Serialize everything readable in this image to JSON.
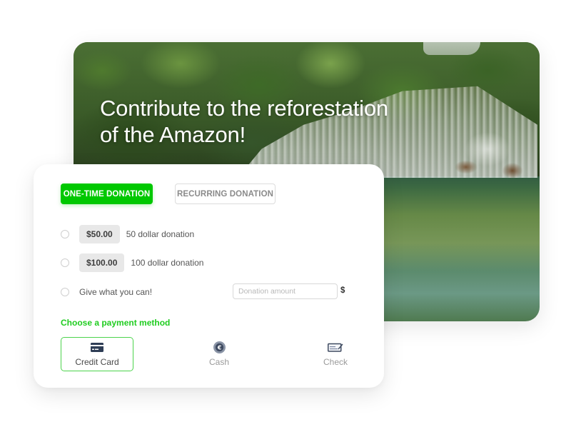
{
  "hero": {
    "title_line1": "Contribute to the reforestation",
    "title_line2": "of the Amazon!",
    "image_description": "waterfall-forest-photo"
  },
  "donation_form": {
    "tabs": [
      {
        "label": "ONE-TIME DONATION",
        "active": true
      },
      {
        "label": "RECURRING DONATION",
        "active": false
      }
    ],
    "options": [
      {
        "amount": "$50.00",
        "label": "50 dollar donation",
        "selected": false
      },
      {
        "amount": "$100.00",
        "label": "100 dollar donation",
        "selected": false
      },
      {
        "label": "Give what you can!",
        "selected": false
      }
    ],
    "custom_amount": {
      "value": "",
      "placeholder": "Donation amount",
      "currency_symbol": "$"
    },
    "payment_heading": "Choose a payment method",
    "payment_methods": [
      {
        "label": "Credit Card",
        "icon": "credit-card-icon",
        "selected": true
      },
      {
        "label": "Cash",
        "icon": "euro-coin-icon",
        "selected": false
      },
      {
        "label": "Check",
        "icon": "check-cheque-icon",
        "selected": false
      }
    ]
  },
  "colors": {
    "accent_green": "#00c800",
    "heading_green": "#1fcc1f",
    "selected_border": "#4cd34c",
    "chip_bg": "#e8e8e8"
  }
}
